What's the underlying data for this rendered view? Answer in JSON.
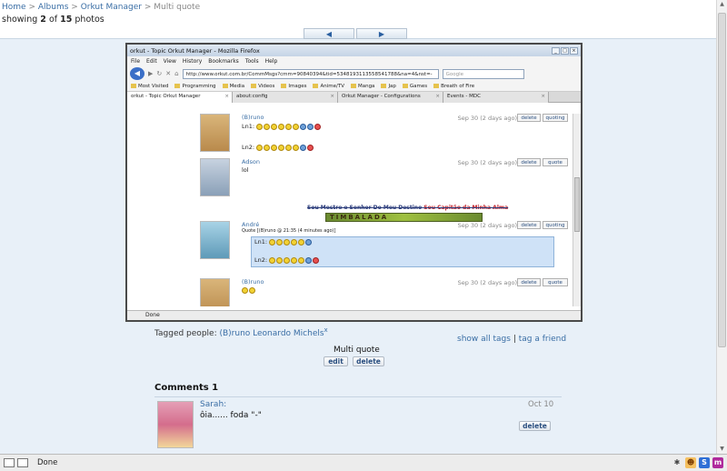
{
  "breadcrumb": {
    "home": "Home",
    "sep": ">",
    "albums": "Albums",
    "orkut_manager": "Orkut Manager",
    "current": "Multi quote"
  },
  "showing": {
    "prefix": "showing",
    "index": "2",
    "of": "of",
    "total": "15",
    "suffix": "photos"
  },
  "nav": {
    "prev_icon": "◀",
    "next_icon": "▶"
  },
  "screenshot": {
    "title": "orkut - Topic Orkut Manager - Mozilla Firefox",
    "menu": [
      "File",
      "Edit",
      "View",
      "History",
      "Bookmarks",
      "Tools",
      "Help"
    ],
    "url": "http://www.orkut.com.br/CommMsgs?cmm=90840394&tid=5348193113558541788&na=4&nst=-",
    "search_placeholder": "Google",
    "bookmarks": [
      "Most Visited",
      "Programming",
      "Media",
      "Videos",
      "Images",
      "Anime/TV",
      "Manga",
      "Jap",
      "Games",
      "Breath of Fire"
    ],
    "tabs": [
      {
        "label": "orkut - Topic Orkut Manager"
      },
      {
        "label": "about:config"
      },
      {
        "label": "Orkut Manager - Configurations"
      },
      {
        "label": "Events - MDC"
      }
    ],
    "status": "Done",
    "posts": [
      {
        "name": "(B)runo",
        "l1": "Ln1:",
        "l2": "Ln2:",
        "date": "Sep 30 (2 days ago)",
        "b1": "delete",
        "b2": "quoting"
      },
      {
        "name": "Adson",
        "l1": "lol",
        "date": "Sep 30 (2 days ago)",
        "b1": "delete",
        "b2": "quote"
      },
      {
        "name": "André",
        "quote": "Quote [(B)runo @ 21:35 (4 minutes ago)]",
        "l1": "Ln1:",
        "l2": "Ln2:",
        "date": "Sep 30 (2 days ago)",
        "b1": "delete",
        "b2": "quoting"
      },
      {
        "name": "(B)runo",
        "date": "Sep 30 (2 days ago)",
        "b1": "delete",
        "b2": "quote"
      }
    ],
    "banner_title_a": "Sou Mestre e Senhor Do Meu Destino",
    "banner_title_b": "Sou Capitão da Minha Alma",
    "banner_text": "TIMBALADA"
  },
  "tagged": {
    "label": "Tagged people:",
    "person": "(B)runo Leonardo Michels",
    "remove": "x"
  },
  "tag_links": {
    "show_all": "show all tags",
    "sep": "|",
    "tag_friend": "tag a friend"
  },
  "photo_caption": "Multi quote",
  "photo_buttons": {
    "edit": "edit",
    "delete": "delete"
  },
  "comments": {
    "header": "Comments 1",
    "items": [
      {
        "name": "Sarah:",
        "date": "Oct 10",
        "text": "ôia...... foda \"-\"",
        "delete": "delete"
      }
    ]
  },
  "statusbar": {
    "text": "Done"
  }
}
